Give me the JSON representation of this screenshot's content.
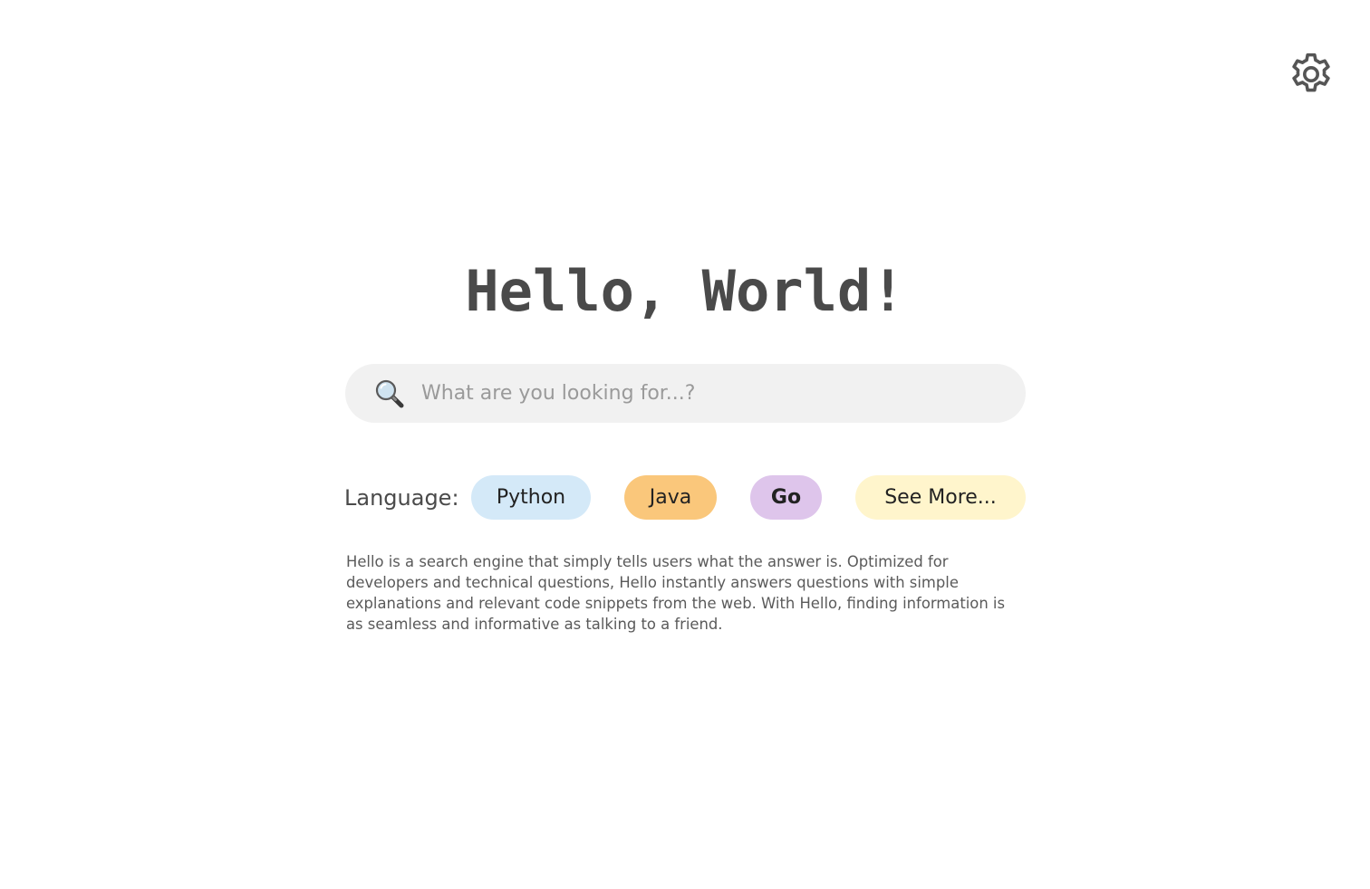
{
  "header": {
    "settings_icon": "gear-icon"
  },
  "main": {
    "title": "Hello, World!",
    "search": {
      "icon": "search-icon",
      "placeholder": "What are you looking for...?",
      "value": ""
    },
    "language": {
      "label": "Language:",
      "options": [
        {
          "label": "Python",
          "color": "#d4e9f8"
        },
        {
          "label": "Java",
          "color": "#fac77b"
        },
        {
          "label": "Go",
          "color": "#dec5eb"
        },
        {
          "label": "See More...",
          "color": "#fff5cc"
        }
      ]
    },
    "description": "Hello is a search engine that simply tells users what the answer is. Optimized for developers and technical questions, Hello instantly answers questions with simple explanations and relevant code snippets from the web. With Hello, finding information is as seamless and informative as talking to a friend."
  },
  "colors": {
    "title": "#4a4a4a",
    "search_background": "#f1f1f1",
    "description_text": "#5a5a5a"
  }
}
